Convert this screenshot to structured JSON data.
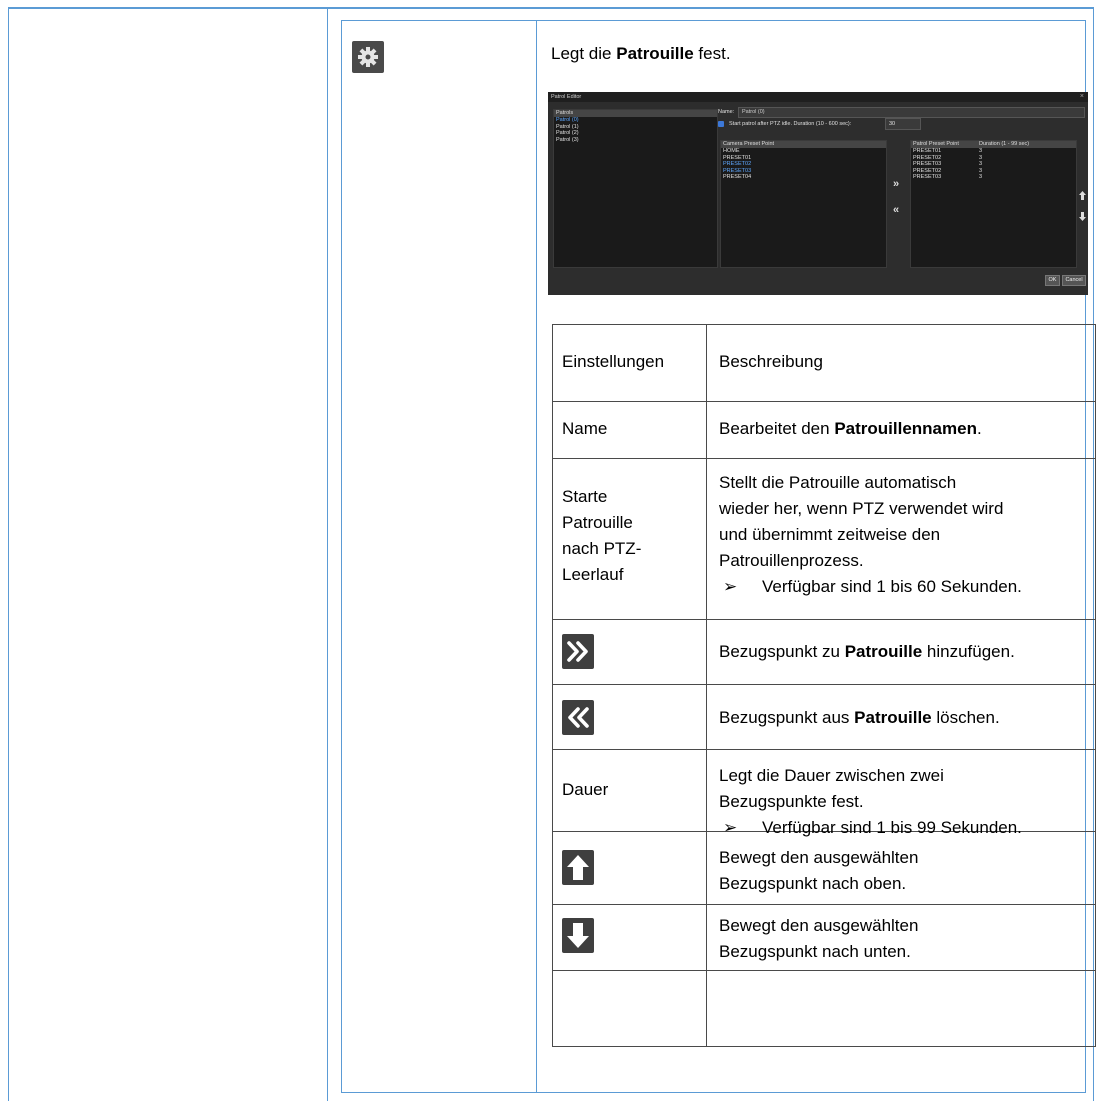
{
  "intro": {
    "pre": "Legt die ",
    "bold": "Patrouille",
    "post": " fest."
  },
  "editor": {
    "title": "Patrol Editor",
    "close": "×",
    "patrols_header": "Patrols",
    "patrols": [
      "Patrol (0)",
      "Patrol (1)",
      "Patrol (2)",
      "Patrol (3)"
    ],
    "name_label": "Name:",
    "name_value": "Patrol (0)",
    "start_label": "Start patrol after PTZ idle.  Duration (10 - 600 sec):",
    "start_value": "30",
    "camera_header": "Camera Preset Point",
    "camera_points": [
      "HOME",
      "PRESET01",
      "PRESET02",
      "PRESET03",
      "PRESET04"
    ],
    "patrol_header_point": "Patrol Preset Point",
    "patrol_header_duration": "Duration (1 - 99 sec)",
    "patrol_points": [
      {
        "point": "PRESET01",
        "duration": "3"
      },
      {
        "point": "PRESET02",
        "duration": "3"
      },
      {
        "point": "PRESET03",
        "duration": "3"
      },
      {
        "point": "PRESET02",
        "duration": "3"
      },
      {
        "point": "PRESET03",
        "duration": "3"
      }
    ],
    "add_arrow": "»",
    "remove_arrow": "«",
    "ok": "OK",
    "cancel": "Cancel"
  },
  "table": {
    "header": {
      "settings": "Einstellungen",
      "description": "Beschreibung"
    },
    "name_row": {
      "setting": "Name",
      "desc_pre": "Bearbeitet den ",
      "desc_bold": "Patrouillennamen",
      "desc_post": "."
    },
    "start_row": {
      "setting_l1": "Starte",
      "setting_l2": "Patrouille",
      "setting_l3": "nach PTZ-",
      "setting_l4": "Leerlauf",
      "desc_l1": "Stellt die Patrouille automatisch",
      "desc_l2": "wieder her, wenn PTZ verwendet wird",
      "desc_l3": "und übernimmt zeitweise den",
      "desc_l4": "Patrouillenprozess.",
      "bullet": "Verfügbar sind 1 bis 60 Sekunden."
    },
    "add_row": {
      "pre": "Bezugspunkt zu ",
      "bold": "Patrouille",
      "post": " hinzufügen."
    },
    "remove_row": {
      "pre": "Bezugspunkt aus ",
      "bold": "Patrouille",
      "post": " löschen."
    },
    "duration_row": {
      "setting": "Dauer",
      "desc_l1": "Legt die Dauer zwischen zwei",
      "desc_l2": "Bezugspunkte fest.",
      "bullet": "Verfügbar sind 1 bis 99 Sekunden."
    },
    "up_row": {
      "l1": "Bewegt den ausgewählten",
      "l2": "Bezugspunkt nach oben."
    },
    "down_row": {
      "l1": "Bewegt den ausgewählten",
      "l2": "Bezugspunkt nach unten."
    },
    "bullet_symbol": "➢"
  }
}
